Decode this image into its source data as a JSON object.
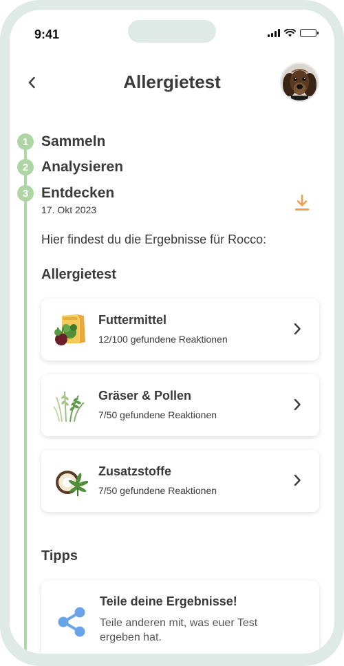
{
  "status_bar": {
    "time": "9:41"
  },
  "header": {
    "title": "Allergietest"
  },
  "steps": [
    {
      "number": "1",
      "label": "Sammeln"
    },
    {
      "number": "2",
      "label": "Analysieren"
    },
    {
      "number": "3",
      "label": "Entdecken",
      "date": "17. Okt 2023"
    }
  ],
  "intro": "Hier findest du die Ergebnisse für Rocco:",
  "results_section": {
    "title": "Allergietest",
    "cards": [
      {
        "title": "Futtermittel",
        "subtitle": "12/100 gefundene Reaktionen",
        "icon": "food-bag-icon"
      },
      {
        "title": "Gräser & Pollen",
        "subtitle": "7/50 gefundene Reaktionen",
        "icon": "grass-icon"
      },
      {
        "title": "Zusatzstoffe",
        "subtitle": "7/50 gefundene Reaktionen",
        "icon": "coconut-leaf-icon"
      }
    ]
  },
  "tips_section": {
    "title": "Tipps",
    "card": {
      "title": "Teile deine Ergebnisse!",
      "text": "Teile anderen mit, was euer Test ergeben hat.",
      "icon": "share-icon"
    }
  },
  "colors": {
    "accent_green": "#aed6a4",
    "download_orange": "#f0a04b",
    "share_blue": "#6aa3e8"
  }
}
